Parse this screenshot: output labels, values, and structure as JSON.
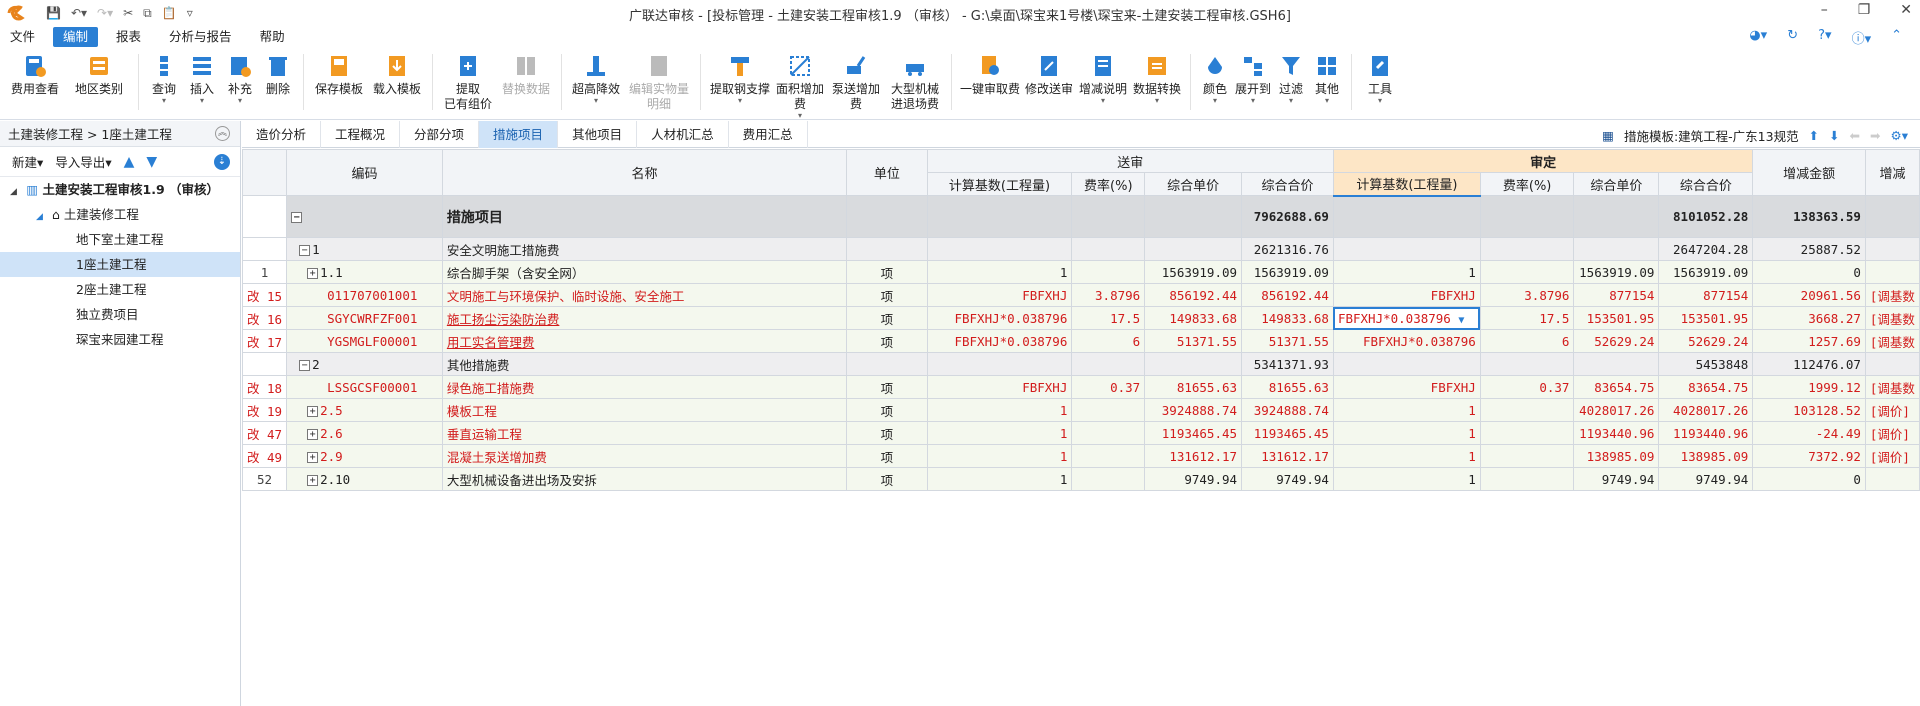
{
  "window": {
    "title": "广联达审核 - [投标管理 - 土建安装工程审核1.9 （审核） - G:\\桌面\\琛宝来1号楼\\琛宝来-土建安装工程审核.GSH6]"
  },
  "menu": [
    {
      "label": "文件"
    },
    {
      "label": "编制"
    },
    {
      "label": "报表"
    },
    {
      "label": "分析与报告"
    },
    {
      "label": "帮助"
    }
  ],
  "toolbar": [
    {
      "label": "费用查看"
    },
    {
      "label": "地区类别"
    },
    {
      "label": "查询"
    },
    {
      "label": "插入"
    },
    {
      "label": "补充"
    },
    {
      "label": "删除"
    },
    {
      "label": "保存模板"
    },
    {
      "label": "载入模板"
    },
    {
      "label": "提取",
      "label2": "已有组价"
    },
    {
      "label": "替换数据"
    },
    {
      "label": "超高降效"
    },
    {
      "label": "编辑实物量",
      "label2": "明细"
    },
    {
      "label": "提取钢支撑"
    },
    {
      "label": "面积增加费"
    },
    {
      "label": "泵送增加费"
    },
    {
      "label": "大型机械",
      "label2": "进退场费"
    },
    {
      "label": "一键审取费"
    },
    {
      "label": "修改送审"
    },
    {
      "label": "增减说明"
    },
    {
      "label": "数据转换"
    },
    {
      "label": "颜色"
    },
    {
      "label": "展开到"
    },
    {
      "label": "过滤"
    },
    {
      "label": "其他"
    },
    {
      "label": "工具"
    }
  ],
  "left": {
    "breadcrumb": "土建装修工程 > 1座土建工程",
    "new_label": "新建",
    "import_label": "导入导出",
    "tree": [
      {
        "label": "土建安装工程审核1.9 （审核）"
      },
      {
        "label": "土建装修工程"
      },
      {
        "label": "地下室土建工程"
      },
      {
        "label": "1座土建工程"
      },
      {
        "label": "2座土建工程"
      },
      {
        "label": "独立费项目"
      },
      {
        "label": "琛宝来园建工程"
      }
    ]
  },
  "tabs": [
    {
      "label": "造价分析"
    },
    {
      "label": "工程概况"
    },
    {
      "label": "分部分项"
    },
    {
      "label": "措施项目"
    },
    {
      "label": "其他项目"
    },
    {
      "label": "人材机汇总"
    },
    {
      "label": "费用汇总"
    }
  ],
  "template_label": "措施模板:建筑工程-广东13规范",
  "headers": {
    "code": "编码",
    "name": "名称",
    "unit": "单位",
    "submit": "送审",
    "approve": "审定",
    "base": "计算基数(工程量)",
    "rate": "费率(%)",
    "price": "综合单价",
    "total": "综合合价",
    "diff": "增减金额",
    "remark": "增减"
  },
  "rows": [
    {
      "no": "",
      "code": "",
      "name": "措施项目",
      "unit": "",
      "s_base": "",
      "s_rate": "",
      "s_price": "",
      "s_total": "7962688.69",
      "a_base": "",
      "a_rate": "",
      "a_price": "",
      "a_total": "8101052.28",
      "diff": "138363.59",
      "remark": ""
    },
    {
      "no": "",
      "code": "1",
      "name": "安全文明施工措施费",
      "unit": "",
      "s_base": "",
      "s_rate": "",
      "s_price": "",
      "s_total": "2621316.76",
      "a_base": "",
      "a_rate": "",
      "a_price": "",
      "a_total": "2647204.28",
      "diff": "25887.52",
      "remark": ""
    },
    {
      "no": "1",
      "code": "1.1",
      "name": "综合脚手架（含安全网）",
      "unit": "项",
      "s_base": "1",
      "s_rate": "",
      "s_price": "1563919.09",
      "s_total": "1563919.09",
      "a_base": "1",
      "a_rate": "",
      "a_price": "1563919.09",
      "a_total": "1563919.09",
      "diff": "0",
      "remark": ""
    },
    {
      "no": "改 15",
      "code": "011707001001",
      "name": "文明施工与环境保护、临时设施、安全施工",
      "unit": "项",
      "s_base": "FBFXHJ",
      "s_rate": "3.8796",
      "s_price": "856192.44",
      "s_total": "856192.44",
      "a_base": "FBFXHJ",
      "a_rate": "3.8796",
      "a_price": "877154",
      "a_total": "877154",
      "diff": "20961.56",
      "remark": "[调基数"
    },
    {
      "no": "改 16",
      "code": "SGYCWRFZF001",
      "name": "施工扬尘污染防治费",
      "unit": "项",
      "s_base": "FBFXHJ*0.038796",
      "s_rate": "17.5",
      "s_price": "149833.68",
      "s_total": "149833.68",
      "a_base": "FBFXHJ*0.038796",
      "a_rate": "17.5",
      "a_price": "153501.95",
      "a_total": "153501.95",
      "diff": "3668.27",
      "remark": "[调基数"
    },
    {
      "no": "改 17",
      "code": "YGSMGLF00001",
      "name": "用工实名管理费",
      "unit": "项",
      "s_base": "FBFXHJ*0.038796",
      "s_rate": "6",
      "s_price": "51371.55",
      "s_total": "51371.55",
      "a_base": "FBFXHJ*0.038796",
      "a_rate": "6",
      "a_price": "52629.24",
      "a_total": "52629.24",
      "diff": "1257.69",
      "remark": "[调基数"
    },
    {
      "no": "",
      "code": "2",
      "name": "其他措施费",
      "unit": "",
      "s_base": "",
      "s_rate": "",
      "s_price": "",
      "s_total": "5341371.93",
      "a_base": "",
      "a_rate": "",
      "a_price": "",
      "a_total": "5453848",
      "diff": "112476.07",
      "remark": ""
    },
    {
      "no": "改 18",
      "code": "LSSGCSF00001",
      "name": "绿色施工措施费",
      "unit": "项",
      "s_base": "FBFXHJ",
      "s_rate": "0.37",
      "s_price": "81655.63",
      "s_total": "81655.63",
      "a_base": "FBFXHJ",
      "a_rate": "0.37",
      "a_price": "83654.75",
      "a_total": "83654.75",
      "diff": "1999.12",
      "remark": "[调基数"
    },
    {
      "no": "改 19",
      "code": "2.5",
      "name": "模板工程",
      "unit": "项",
      "s_base": "1",
      "s_rate": "",
      "s_price": "3924888.74",
      "s_total": "3924888.74",
      "a_base": "1",
      "a_rate": "",
      "a_price": "4028017.26",
      "a_total": "4028017.26",
      "diff": "103128.52",
      "remark": "[调价]"
    },
    {
      "no": "改 47",
      "code": "2.6",
      "name": "垂直运输工程",
      "unit": "项",
      "s_base": "1",
      "s_rate": "",
      "s_price": "1193465.45",
      "s_total": "1193465.45",
      "a_base": "1",
      "a_rate": "",
      "a_price": "1193440.96",
      "a_total": "1193440.96",
      "diff": "-24.49",
      "remark": "[调价]"
    },
    {
      "no": "改 49",
      "code": "2.9",
      "name": "混凝土泵送增加费",
      "unit": "项",
      "s_base": "1",
      "s_rate": "",
      "s_price": "131612.17",
      "s_total": "131612.17",
      "a_base": "1",
      "a_rate": "",
      "a_price": "138985.09",
      "a_total": "138985.09",
      "diff": "7372.92",
      "remark": "[调价]"
    },
    {
      "no": "52",
      "code": "2.10",
      "name": "大型机械设备进出场及安拆",
      "unit": "项",
      "s_base": "1",
      "s_rate": "",
      "s_price": "9749.94",
      "s_total": "9749.94",
      "a_base": "1",
      "a_rate": "",
      "a_price": "9749.94",
      "a_total": "9749.94",
      "diff": "0",
      "remark": ""
    }
  ]
}
